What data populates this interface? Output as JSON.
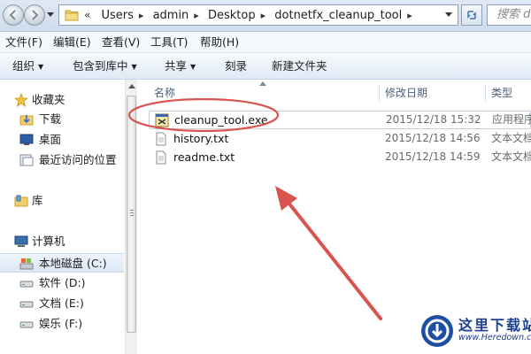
{
  "address_bar": {
    "lead": "«",
    "crumbs": [
      "Users",
      "admin",
      "Desktop",
      "dotnetfx_cleanup_tool"
    ],
    "search_placeholder": "搜索 d"
  },
  "menu": [
    "文件(F)",
    "编辑(E)",
    "查看(V)",
    "工具(T)",
    "帮助(H)"
  ],
  "toolbar": {
    "organize": "组织",
    "include_in_library": "包含到库中",
    "share": "共享",
    "burn": "刻录",
    "new_folder": "新建文件夹"
  },
  "nav": {
    "favorites": "收藏夹",
    "downloads": "下载",
    "desktop": "桌面",
    "recent": "最近访问的位置",
    "libraries": "库",
    "computer": "计算机",
    "local_disk": "本地磁盘 (C:)",
    "drive_d": "软件 (D:)",
    "drive_e": "文档 (E:)",
    "drive_f": "娱乐 (F:)"
  },
  "columns": {
    "name": "名称",
    "modified": "修改日期",
    "type": "类型"
  },
  "files": [
    {
      "name": "cleanup_tool.exe",
      "date": "2015/12/18 15:32",
      "type": "应用程序",
      "icon": "exe-icon"
    },
    {
      "name": "history.txt",
      "date": "2015/12/18 14:56",
      "type": "文本文档",
      "icon": "text-file-icon"
    },
    {
      "name": "readme.txt",
      "date": "2015/12/18 14:59",
      "type": "文本文档",
      "icon": "text-file-icon"
    }
  ],
  "watermark": {
    "title": "这里下载站",
    "url": "www.Heredown.com"
  },
  "colors": {
    "annotation": "#d9534f",
    "watermark": "#1d3f8f"
  }
}
